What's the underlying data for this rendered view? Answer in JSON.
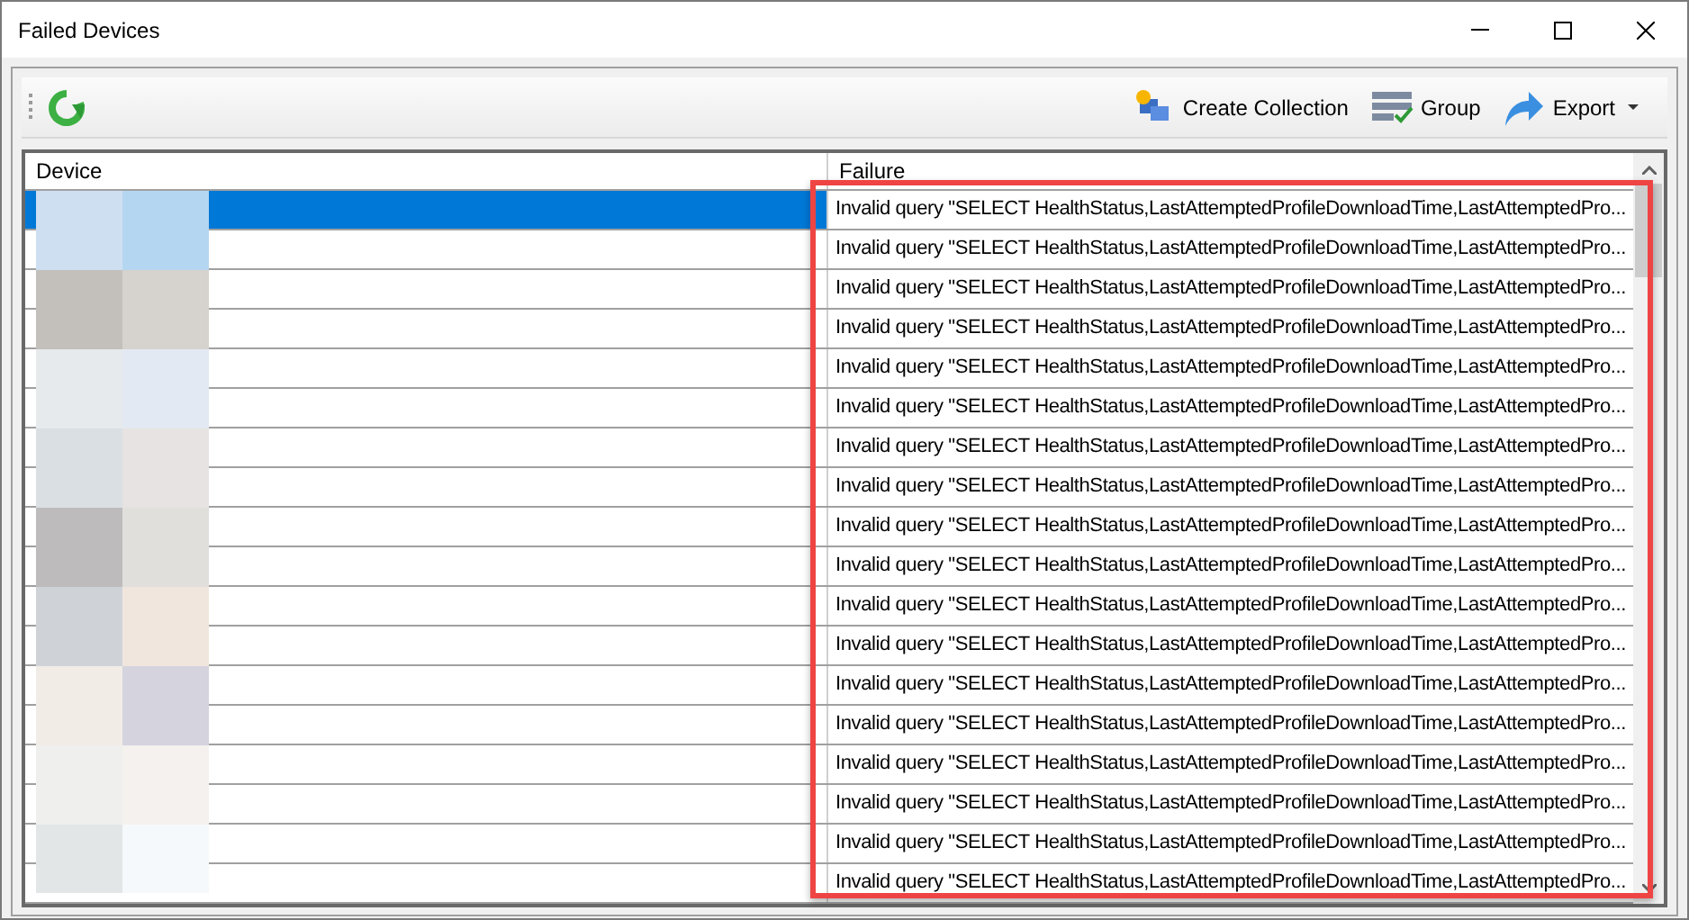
{
  "window": {
    "title": "Failed Devices"
  },
  "toolbar": {
    "actions": [
      {
        "label": "Create Collection",
        "kind": "collection"
      },
      {
        "label": "Group",
        "kind": "group"
      },
      {
        "label": "Export",
        "kind": "export"
      }
    ]
  },
  "table": {
    "columns": [
      "Device",
      "Failure"
    ],
    "rows": [
      {
        "selected": true,
        "failure": "Invalid query \"SELECT HealthStatus,LastAttemptedProfileDownloadTime,LastAttemptedPro..."
      },
      {
        "selected": false,
        "failure": "Invalid query \"SELECT HealthStatus,LastAttemptedProfileDownloadTime,LastAttemptedPro..."
      },
      {
        "selected": false,
        "failure": "Invalid query \"SELECT HealthStatus,LastAttemptedProfileDownloadTime,LastAttemptedPro..."
      },
      {
        "selected": false,
        "failure": "Invalid query \"SELECT HealthStatus,LastAttemptedProfileDownloadTime,LastAttemptedPro..."
      },
      {
        "selected": false,
        "failure": "Invalid query \"SELECT HealthStatus,LastAttemptedProfileDownloadTime,LastAttemptedPro..."
      },
      {
        "selected": false,
        "failure": "Invalid query \"SELECT HealthStatus,LastAttemptedProfileDownloadTime,LastAttemptedPro..."
      },
      {
        "selected": false,
        "failure": "Invalid query \"SELECT HealthStatus,LastAttemptedProfileDownloadTime,LastAttemptedPro..."
      },
      {
        "selected": false,
        "failure": "Invalid query \"SELECT HealthStatus,LastAttemptedProfileDownloadTime,LastAttemptedPro..."
      },
      {
        "selected": false,
        "failure": "Invalid query \"SELECT HealthStatus,LastAttemptedProfileDownloadTime,LastAttemptedPro..."
      },
      {
        "selected": false,
        "failure": "Invalid query \"SELECT HealthStatus,LastAttemptedProfileDownloadTime,LastAttemptedPro..."
      },
      {
        "selected": false,
        "failure": "Invalid query \"SELECT HealthStatus,LastAttemptedProfileDownloadTime,LastAttemptedPro..."
      },
      {
        "selected": false,
        "failure": "Invalid query \"SELECT HealthStatus,LastAttemptedProfileDownloadTime,LastAttemptedPro..."
      },
      {
        "selected": false,
        "failure": "Invalid query \"SELECT HealthStatus,LastAttemptedProfileDownloadTime,LastAttemptedPro..."
      },
      {
        "selected": false,
        "failure": "Invalid query \"SELECT HealthStatus,LastAttemptedProfileDownloadTime,LastAttemptedPro..."
      },
      {
        "selected": false,
        "failure": "Invalid query \"SELECT HealthStatus,LastAttemptedProfileDownloadTime,LastAttemptedPro..."
      },
      {
        "selected": false,
        "failure": "Invalid query \"SELECT HealthStatus,LastAttemptedProfileDownloadTime,LastAttemptedPro..."
      },
      {
        "selected": false,
        "failure": "Invalid query \"SELECT HealthStatus,LastAttemptedProfileDownloadTime,LastAttemptedPro..."
      },
      {
        "selected": false,
        "failure": "Invalid query \"SELECT HealthStatus,LastAttemptedProfileDownloadTime,LastAttemptedPro..."
      }
    ]
  }
}
